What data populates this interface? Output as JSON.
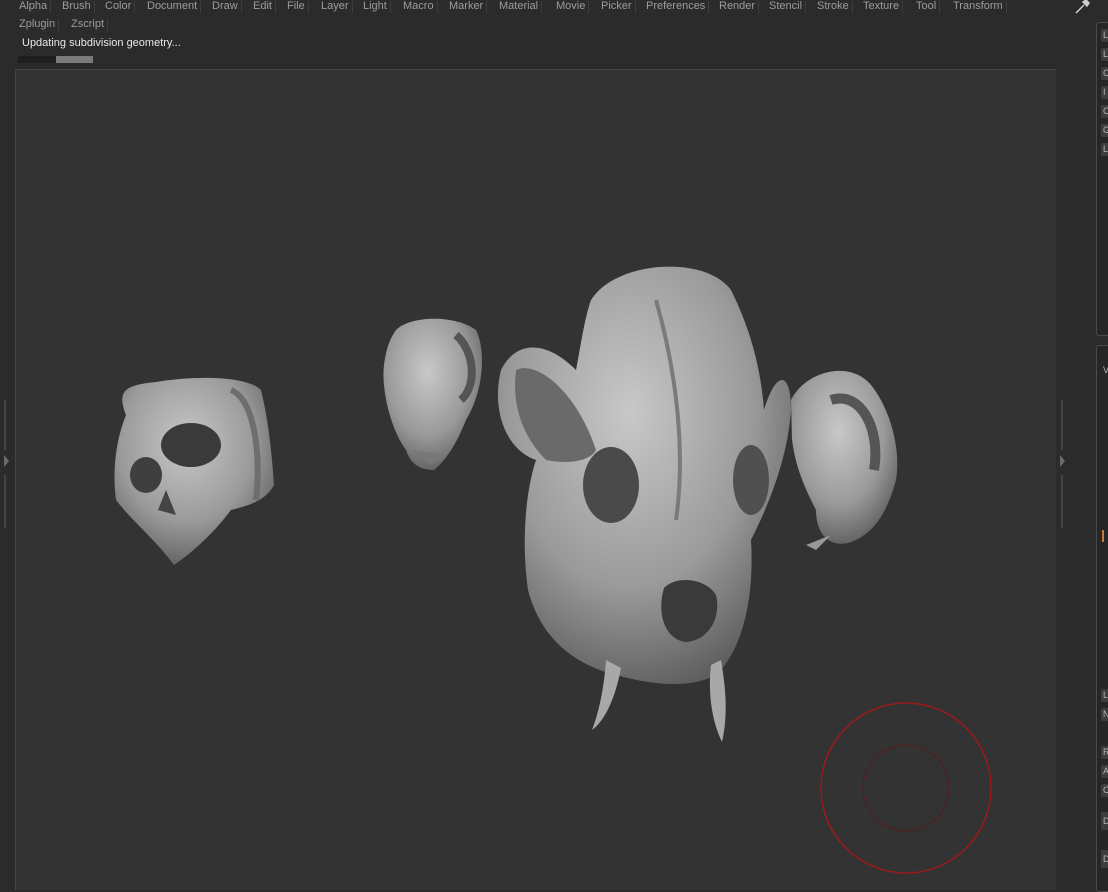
{
  "menu": {
    "row1": [
      "Alpha",
      "Brush",
      "Color",
      "Document",
      "Draw",
      "Edit",
      "File",
      "Layer",
      "Light",
      "Macro",
      "Marker",
      "Material",
      "Movie",
      "Picker",
      "Preferences",
      "Render",
      "Stencil",
      "Stroke",
      "Texture",
      "Tool",
      "Transform"
    ],
    "row2": [
      "Zplugin",
      "Zscript"
    ]
  },
  "status": {
    "message": "Updating subdivision geometry...",
    "progress": 0.5
  },
  "right_panel": {
    "title_fragment": "T",
    "buttons": [
      "L",
      "L",
      "C",
      "I",
      "C",
      "G",
      "L",
      "V",
      "L",
      "N",
      "R",
      "A",
      "C",
      "D",
      "D"
    ]
  },
  "colors": {
    "brush_cursor": "#9b1a1a",
    "canvas": "#333333",
    "background": "#2b2b2b",
    "accent": "#c97a2a"
  },
  "icons": {
    "tool": "brush-tool-icon"
  }
}
